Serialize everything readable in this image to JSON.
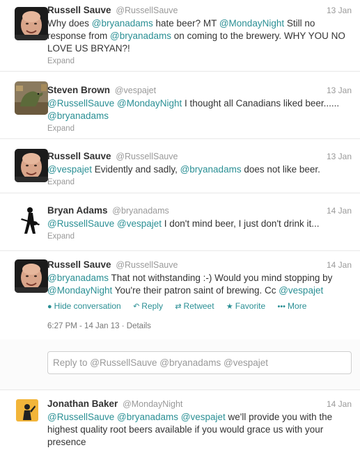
{
  "tweets": [
    {
      "fullname": "Russell Sauve",
      "username": "@RussellSauve",
      "time": "13 Jan",
      "text": [
        {
          "t": "Why does ",
          "m": false
        },
        {
          "t": "@bryanadams",
          "m": true
        },
        {
          "t": " hate beer? MT ",
          "m": false
        },
        {
          "t": "@MondayNight",
          "m": true
        },
        {
          "t": " Still no response from ",
          "m": false
        },
        {
          "t": "@bryanadams",
          "m": true
        },
        {
          "t": " on coming to the brewery. WHY YOU NO LOVE US BRYAN?!",
          "m": false
        }
      ],
      "expand": "Expand",
      "avatar": "bald-man"
    },
    {
      "fullname": "Steven Brown",
      "username": "@vespajet",
      "time": "13 Jan",
      "text": [
        {
          "t": "@RussellSauve",
          "m": true
        },
        {
          "t": " ",
          "m": false
        },
        {
          "t": "@MondayNight",
          "m": true
        },
        {
          "t": " I thought all Canadians liked beer...... ",
          "m": false
        },
        {
          "t": "@bryanadams",
          "m": true
        }
      ],
      "expand": "Expand",
      "avatar": "dinosaur"
    },
    {
      "fullname": "Russell Sauve",
      "username": "@RussellSauve",
      "time": "13 Jan",
      "text": [
        {
          "t": "@vespajet",
          "m": true
        },
        {
          "t": " Evidently and sadly, ",
          "m": false
        },
        {
          "t": "@bryanadams",
          "m": true
        },
        {
          "t": " does not like beer.",
          "m": false
        }
      ],
      "expand": "Expand",
      "avatar": "bald-man"
    },
    {
      "fullname": "Bryan Adams",
      "username": "@bryanadams",
      "time": "14 Jan",
      "text": [
        {
          "t": "@RussellSauve",
          "m": true
        },
        {
          "t": " ",
          "m": false
        },
        {
          "t": "@vespajet",
          "m": true
        },
        {
          "t": " I don't mind beer, I just don't drink it...",
          "m": false
        }
      ],
      "expand": "Expand",
      "avatar": "guitarist"
    },
    {
      "fullname": "Russell Sauve",
      "username": "@RussellSauve",
      "time": "14 Jan",
      "text": [
        {
          "t": "@bryanadams",
          "m": true
        },
        {
          "t": " That not withstanding :-) Would you mind stopping by ",
          "m": false
        },
        {
          "t": "@MondayNight",
          "m": true
        },
        {
          "t": " You're their patron saint of brewing. Cc ",
          "m": false
        },
        {
          "t": "@vespajet",
          "m": true
        }
      ],
      "avatar": "bald-man",
      "actions": {
        "hide": "Hide conversation",
        "reply": "Reply",
        "retweet": "Retweet",
        "favorite": "Favorite",
        "more": "More"
      },
      "details": "6:27 PM - 14 Jan 13 · Details"
    },
    {
      "fullname": "Jonathan Baker",
      "username": "@MondayNight",
      "time": "14 Jan",
      "text": [
        {
          "t": "@RussellSauve",
          "m": true
        },
        {
          "t": " ",
          "m": false
        },
        {
          "t": "@bryanadams",
          "m": true
        },
        {
          "t": " ",
          "m": false
        },
        {
          "t": "@vespajet",
          "m": true
        },
        {
          "t": " we'll provide you with the highest quality root beers available if you would grace us with your presence",
          "m": false
        }
      ],
      "avatar": "brewery-logo"
    }
  ],
  "reply_box": {
    "placeholder": "Reply to @RussellSauve @bryanadams @vespajet"
  },
  "colors": {
    "mention": "#2a8f94",
    "muted": "#999999"
  }
}
